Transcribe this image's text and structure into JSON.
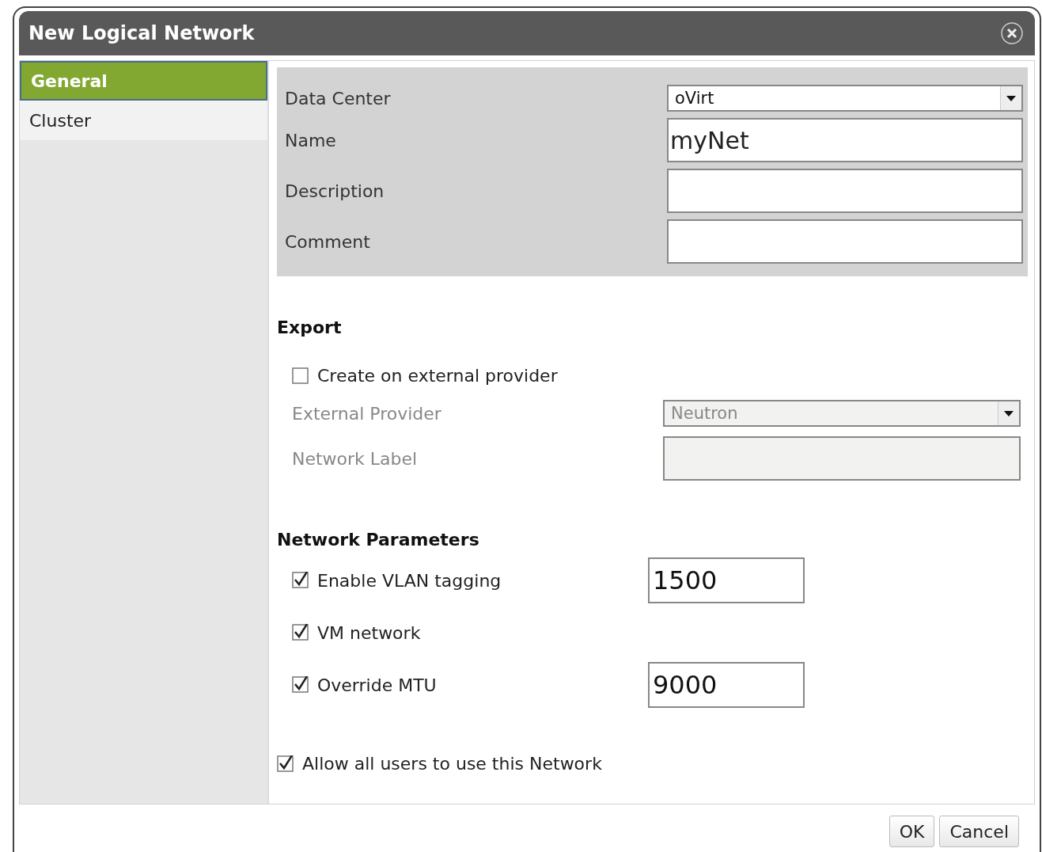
{
  "window": {
    "title": "New Logical Network"
  },
  "sidebar": {
    "items": [
      {
        "label": "General",
        "selected": true
      },
      {
        "label": "Cluster",
        "selected": false
      }
    ]
  },
  "general_fields": [
    {
      "kind": "select",
      "label": "Data Center",
      "value": "oVirt"
    },
    {
      "kind": "input",
      "label": "Name",
      "value": "myNet"
    },
    {
      "kind": "input",
      "label": "Description"
    },
    {
      "kind": "input",
      "label": "Comment"
    }
  ],
  "export": {
    "heading": "Export",
    "create_on_external_provider": {
      "label": "Create on external provider",
      "checked": false
    },
    "fields": [
      {
        "kind": "select",
        "label": "External Provider",
        "value": "Neutron",
        "disabled": true
      },
      {
        "kind": "input",
        "label": "Network Label",
        "disabled": true
      }
    ]
  },
  "network_parameters": {
    "heading": "Network Parameters",
    "rows": [
      {
        "label": "Enable VLAN tagging",
        "checked": true,
        "value": "1500"
      },
      {
        "label": "VM network",
        "checked": true
      },
      {
        "label": "Override MTU",
        "checked": true,
        "value": "9000"
      }
    ]
  },
  "allow_all_users": {
    "label": "Allow all users to use this Network",
    "checked": true
  },
  "buttons": [
    "OK",
    "Cancel"
  ]
}
